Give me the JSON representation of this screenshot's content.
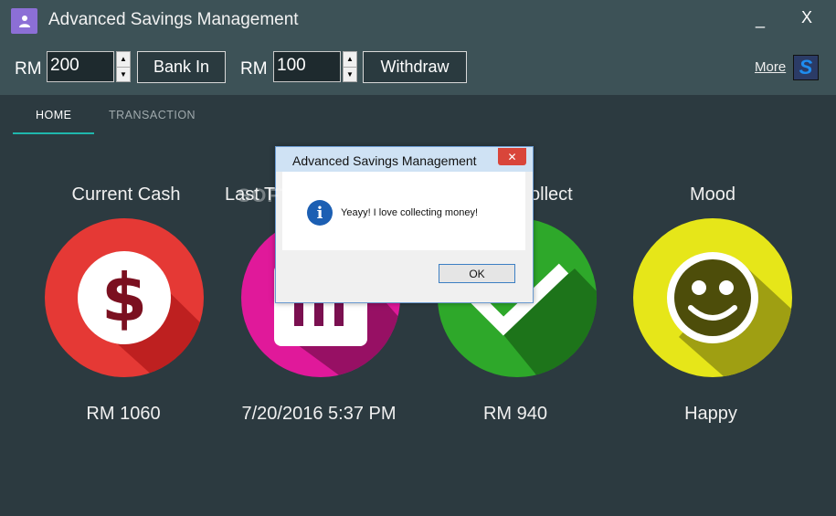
{
  "window": {
    "title": "Advanced Savings Management",
    "minimize_glyph": "_",
    "close_glyph": "X"
  },
  "toolbar": {
    "deposit": {
      "currency": "RM",
      "amount": "200",
      "button_label": "Bank In"
    },
    "withdraw": {
      "currency": "RM",
      "amount": "100",
      "button_label": "Withdraw"
    },
    "more_label": "More",
    "logo_letter": "S"
  },
  "tabs": [
    {
      "label": "HOME",
      "active": true
    },
    {
      "label": "TRANSACTION",
      "active": false
    }
  ],
  "cards": [
    {
      "label": "Current Cash",
      "value": "RM 1060",
      "color": "#e53935",
      "icon": "dollar-icon"
    },
    {
      "label": "Last Transaction",
      "label_visible": "Last T",
      "value": "7/20/2016 5:37 PM",
      "color": "#e0199a",
      "icon": "calendar-icon"
    },
    {
      "label": "To Collect",
      "label_visible": "ollect",
      "value": "RM 940",
      "color": "#2ea82a",
      "icon": "checkmark-icon"
    },
    {
      "label": "Mood",
      "value": "Happy",
      "color": "#e6e619",
      "icon": "smiley-icon"
    }
  ],
  "dialog": {
    "title": "Advanced Savings Management",
    "message": "Yeayy! I love collecting money!",
    "ok_label": "OK",
    "close_glyph": "✕",
    "icon": "info-icon",
    "info_glyph": "i",
    "watermark": "SOFTPEDIA"
  },
  "colors": {
    "background": "#2c3a40",
    "header": "#3d5257",
    "tab_accent": "#1fb7ad",
    "app_icon": "#8c6fd6"
  }
}
